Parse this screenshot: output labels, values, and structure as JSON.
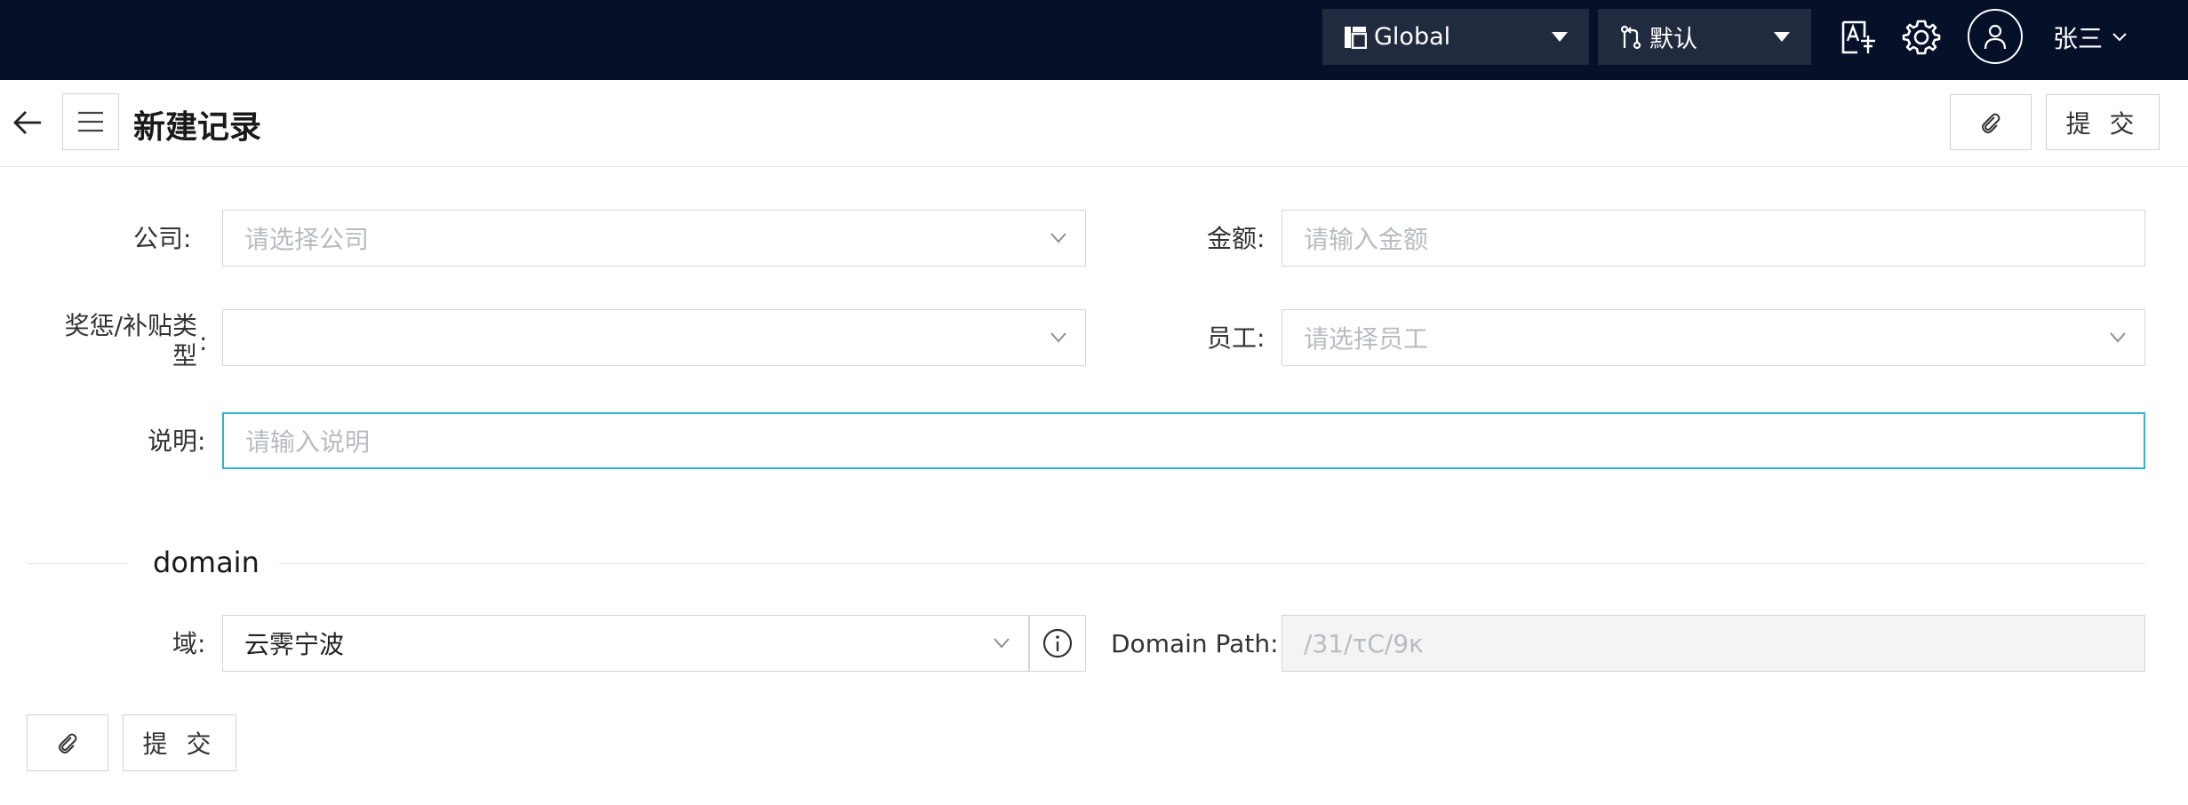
{
  "topbar": {
    "tenant_select": {
      "label": "Global",
      "icon": "layout-icon"
    },
    "branch_select": {
      "label": "默认",
      "icon": "branch-icon"
    },
    "icons": [
      "translate-icon",
      "gear-icon",
      "user-icon"
    ],
    "username": "张三"
  },
  "header": {
    "title": "新建记录",
    "attach_icon": "paperclip-icon",
    "submit_label": "提 交"
  },
  "form": {
    "company": {
      "label": "公司",
      "placeholder": "请选择公司"
    },
    "amount": {
      "label": "金额",
      "placeholder": "请输入金额"
    },
    "type": {
      "label_line1": "奖惩/补贴类",
      "label_line2": "型",
      "value": ""
    },
    "employee": {
      "label": "员工",
      "placeholder": "请选择员工"
    },
    "description": {
      "label": "说明",
      "placeholder": "请输入说明"
    }
  },
  "domain_section": {
    "title": "domain",
    "domain": {
      "label": "域",
      "value": "云霁宁波"
    },
    "domain_path": {
      "label": "Domain Path",
      "value": "/31/τC/9κ"
    }
  },
  "footer": {
    "attach_icon": "paperclip-icon",
    "submit_label": "提 交"
  },
  "colors": {
    "topbar_bg": "#061129",
    "select_bg": "#212b3f",
    "focus_border": "#2cb5d6"
  }
}
